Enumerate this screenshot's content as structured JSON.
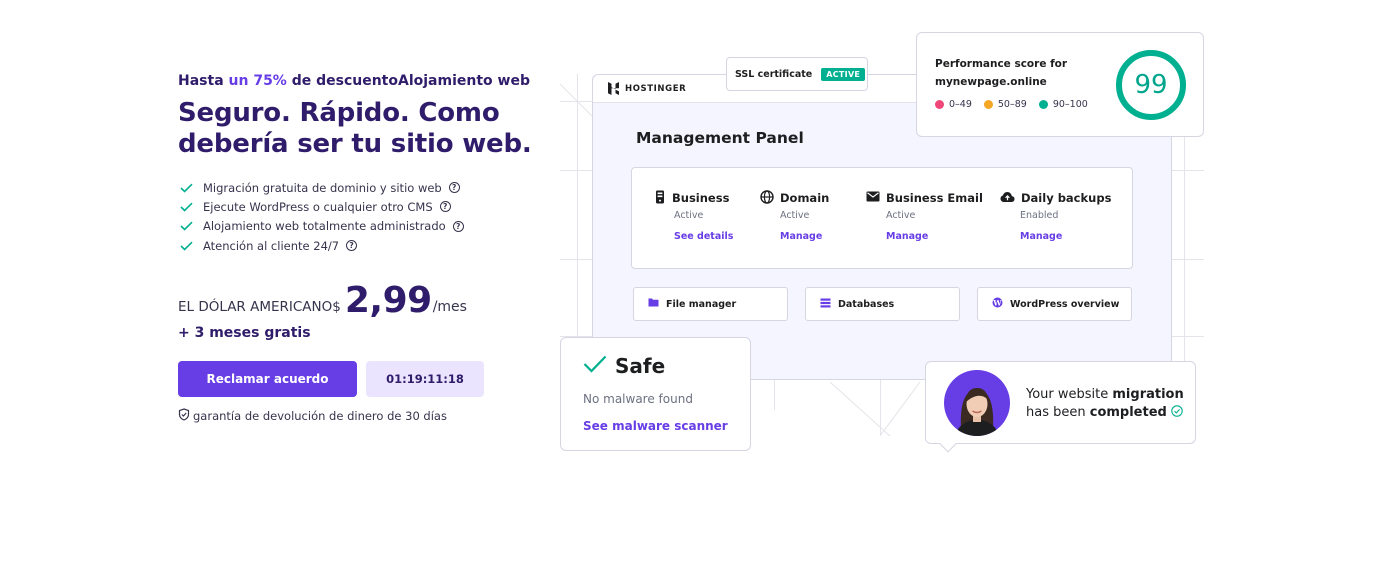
{
  "hero": {
    "eyebrow_prefix": "Hasta ",
    "eyebrow_accent": "un 75%",
    "eyebrow_suffix": " de descuentoAlojamiento web",
    "headline_line1": "Seguro. Rápido. Como",
    "headline_line2": "debería ser tu sitio web.",
    "features": [
      "Migración gratuita de dominio y sitio web",
      "Ejecute WordPress o cualquier otro CMS",
      "Alojamiento web totalmente administrado",
      "Atención al cliente 24/7"
    ],
    "currency": "EL DÓLAR AMERICANO$",
    "price": "2,99",
    "period": "/mes",
    "bonus": "+ 3 meses gratis",
    "cta_label": "Reclamar acuerdo",
    "timer": "01:19:11:18",
    "guarantee": "garantía de devolución de dinero de 30 días"
  },
  "panel": {
    "brand": "HOSTINGER",
    "title": "Management Panel",
    "services": [
      {
        "name": "Business",
        "status": "Active",
        "link": "See details"
      },
      {
        "name": "Domain",
        "status": "Active",
        "link": "Manage"
      },
      {
        "name": "Business Email",
        "status": "Active",
        "link": "Manage"
      },
      {
        "name": "Daily backups",
        "status": "Enabled",
        "link": "Manage"
      }
    ],
    "tools": [
      "File manager",
      "Databases",
      "WordPress overview"
    ]
  },
  "ssl": {
    "label": "SSL certificate",
    "badge": "ACTIVE"
  },
  "performance": {
    "title_line1": "Performance score for",
    "title_line2": "mynewpage.online",
    "score": "99",
    "score_fraction": 0.99,
    "legend": [
      {
        "label": "0–49",
        "color": "#f0467a"
      },
      {
        "label": "50–89",
        "color": "#f5a623"
      },
      {
        "label": "90–100",
        "color": "#00b090"
      }
    ]
  },
  "safe": {
    "title": "Safe",
    "subtitle": "No malware found",
    "link": "See malware scanner"
  },
  "migration": {
    "line1_prefix": "Your website ",
    "line1_bold": "migration",
    "line2_prefix": "has been ",
    "line2_bold": "completed"
  },
  "colors": {
    "accent": "#673de6",
    "success": "#00b090",
    "text": "#2f1c6a"
  }
}
